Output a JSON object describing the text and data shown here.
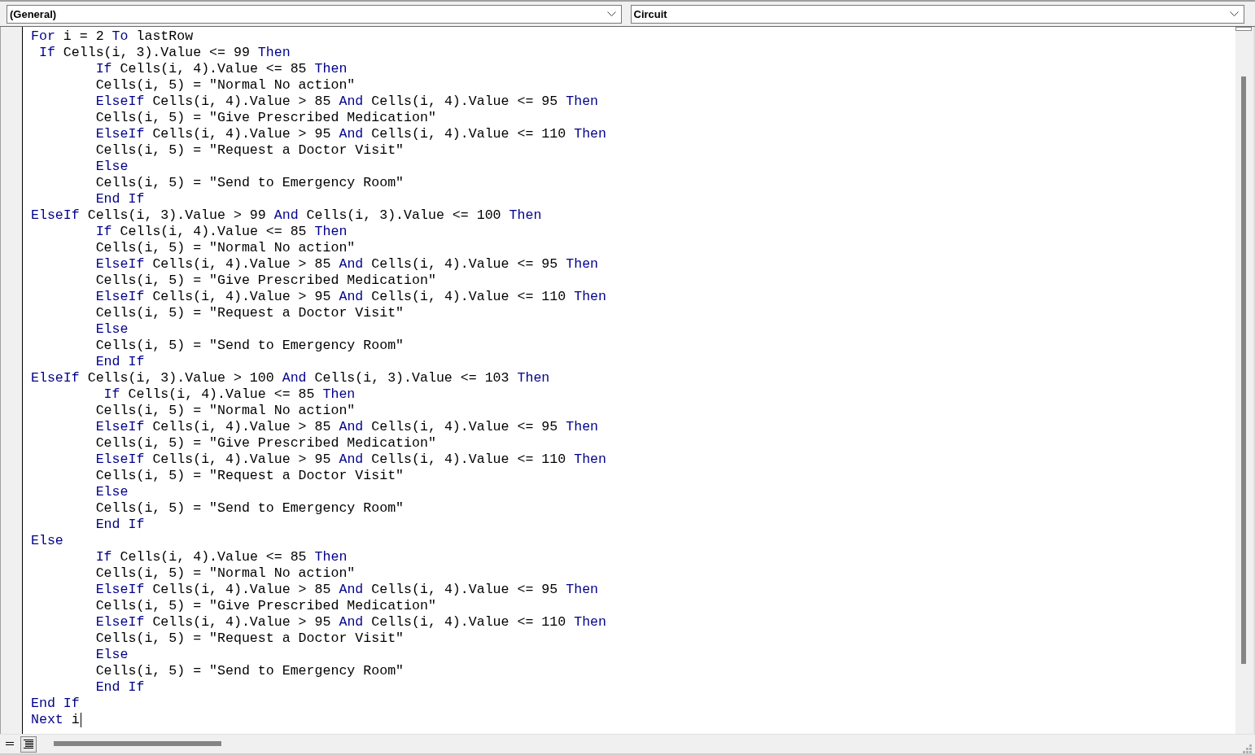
{
  "object_dropdown": {
    "value": "(General)"
  },
  "procedure_dropdown": {
    "value": "Circuit"
  },
  "code_lines": [
    [
      {
        "kind": "keyword",
        "text": "For"
      },
      {
        "kind": "plain",
        "text": " i = 2 "
      },
      {
        "kind": "keyword",
        "text": "To"
      },
      {
        "kind": "plain",
        "text": " lastRow"
      }
    ],
    [
      {
        "kind": "keyword",
        "text": " If"
      },
      {
        "kind": "plain",
        "text": " Cells(i, 3).Value <= 99 "
      },
      {
        "kind": "keyword",
        "text": "Then"
      }
    ],
    [
      {
        "kind": "keyword",
        "text": "        If"
      },
      {
        "kind": "plain",
        "text": " Cells(i, 4).Value <= 85 "
      },
      {
        "kind": "keyword",
        "text": "Then"
      }
    ],
    [
      {
        "kind": "plain",
        "text": "        Cells(i, 5) = \"Normal No action\""
      }
    ],
    [
      {
        "kind": "keyword",
        "text": "        ElseIf"
      },
      {
        "kind": "plain",
        "text": " Cells(i, 4).Value > 85 "
      },
      {
        "kind": "keyword",
        "text": "And"
      },
      {
        "kind": "plain",
        "text": " Cells(i, 4).Value <= 95 "
      },
      {
        "kind": "keyword",
        "text": "Then"
      }
    ],
    [
      {
        "kind": "plain",
        "text": "        Cells(i, 5) = \"Give Prescribed Medication\""
      }
    ],
    [
      {
        "kind": "keyword",
        "text": "        ElseIf"
      },
      {
        "kind": "plain",
        "text": " Cells(i, 4).Value > 95 "
      },
      {
        "kind": "keyword",
        "text": "And"
      },
      {
        "kind": "plain",
        "text": " Cells(i, 4).Value <= 110 "
      },
      {
        "kind": "keyword",
        "text": "Then"
      }
    ],
    [
      {
        "kind": "plain",
        "text": "        Cells(i, 5) = \"Request a Doctor Visit\""
      }
    ],
    [
      {
        "kind": "keyword",
        "text": "        Else"
      }
    ],
    [
      {
        "kind": "plain",
        "text": "        Cells(i, 5) = \"Send to Emergency Room\""
      }
    ],
    [
      {
        "kind": "keyword",
        "text": "        End If"
      }
    ],
    [
      {
        "kind": "keyword",
        "text": "ElseIf"
      },
      {
        "kind": "plain",
        "text": " Cells(i, 3).Value > 99 "
      },
      {
        "kind": "keyword",
        "text": "And"
      },
      {
        "kind": "plain",
        "text": " Cells(i, 3).Value <= 100 "
      },
      {
        "kind": "keyword",
        "text": "Then"
      }
    ],
    [
      {
        "kind": "keyword",
        "text": "        If"
      },
      {
        "kind": "plain",
        "text": " Cells(i, 4).Value <= 85 "
      },
      {
        "kind": "keyword",
        "text": "Then"
      }
    ],
    [
      {
        "kind": "plain",
        "text": "        Cells(i, 5) = \"Normal No action\""
      }
    ],
    [
      {
        "kind": "keyword",
        "text": "        ElseIf"
      },
      {
        "kind": "plain",
        "text": " Cells(i, 4).Value > 85 "
      },
      {
        "kind": "keyword",
        "text": "And"
      },
      {
        "kind": "plain",
        "text": " Cells(i, 4).Value <= 95 "
      },
      {
        "kind": "keyword",
        "text": "Then"
      }
    ],
    [
      {
        "kind": "plain",
        "text": "        Cells(i, 5) = \"Give Prescribed Medication\""
      }
    ],
    [
      {
        "kind": "keyword",
        "text": "        ElseIf"
      },
      {
        "kind": "plain",
        "text": " Cells(i, 4).Value > 95 "
      },
      {
        "kind": "keyword",
        "text": "And"
      },
      {
        "kind": "plain",
        "text": " Cells(i, 4).Value <= 110 "
      },
      {
        "kind": "keyword",
        "text": "Then"
      }
    ],
    [
      {
        "kind": "plain",
        "text": "        Cells(i, 5) = \"Request a Doctor Visit\""
      }
    ],
    [
      {
        "kind": "keyword",
        "text": "        Else"
      }
    ],
    [
      {
        "kind": "plain",
        "text": "        Cells(i, 5) = \"Send to Emergency Room\""
      }
    ],
    [
      {
        "kind": "keyword",
        "text": "        End If"
      }
    ],
    [
      {
        "kind": "keyword",
        "text": "ElseIf"
      },
      {
        "kind": "plain",
        "text": " Cells(i, 3).Value > 100 "
      },
      {
        "kind": "keyword",
        "text": "And"
      },
      {
        "kind": "plain",
        "text": " Cells(i, 3).Value <= 103 "
      },
      {
        "kind": "keyword",
        "text": "Then"
      }
    ],
    [
      {
        "kind": "keyword",
        "text": "         If"
      },
      {
        "kind": "plain",
        "text": " Cells(i, 4).Value <= 85 "
      },
      {
        "kind": "keyword",
        "text": "Then"
      }
    ],
    [
      {
        "kind": "plain",
        "text": "        Cells(i, 5) = \"Normal No action\""
      }
    ],
    [
      {
        "kind": "keyword",
        "text": "        ElseIf"
      },
      {
        "kind": "plain",
        "text": " Cells(i, 4).Value > 85 "
      },
      {
        "kind": "keyword",
        "text": "And"
      },
      {
        "kind": "plain",
        "text": " Cells(i, 4).Value <= 95 "
      },
      {
        "kind": "keyword",
        "text": "Then"
      }
    ],
    [
      {
        "kind": "plain",
        "text": "        Cells(i, 5) = \"Give Prescribed Medication\""
      }
    ],
    [
      {
        "kind": "keyword",
        "text": "        ElseIf"
      },
      {
        "kind": "plain",
        "text": " Cells(i, 4).Value > 95 "
      },
      {
        "kind": "keyword",
        "text": "And"
      },
      {
        "kind": "plain",
        "text": " Cells(i, 4).Value <= 110 "
      },
      {
        "kind": "keyword",
        "text": "Then"
      }
    ],
    [
      {
        "kind": "plain",
        "text": "        Cells(i, 5) = \"Request a Doctor Visit\""
      }
    ],
    [
      {
        "kind": "keyword",
        "text": "        Else"
      }
    ],
    [
      {
        "kind": "plain",
        "text": "        Cells(i, 5) = \"Send to Emergency Room\""
      }
    ],
    [
      {
        "kind": "keyword",
        "text": "        End If"
      }
    ],
    [
      {
        "kind": "keyword",
        "text": "Else"
      }
    ],
    [
      {
        "kind": "keyword",
        "text": "        If"
      },
      {
        "kind": "plain",
        "text": " Cells(i, 4).Value <= 85 "
      },
      {
        "kind": "keyword",
        "text": "Then"
      }
    ],
    [
      {
        "kind": "plain",
        "text": "        Cells(i, 5) = \"Normal No action\""
      }
    ],
    [
      {
        "kind": "keyword",
        "text": "        ElseIf"
      },
      {
        "kind": "plain",
        "text": " Cells(i, 4).Value > 85 "
      },
      {
        "kind": "keyword",
        "text": "And"
      },
      {
        "kind": "plain",
        "text": " Cells(i, 4).Value <= 95 "
      },
      {
        "kind": "keyword",
        "text": "Then"
      }
    ],
    [
      {
        "kind": "plain",
        "text": "        Cells(i, 5) = \"Give Prescribed Medication\""
      }
    ],
    [
      {
        "kind": "keyword",
        "text": "        ElseIf"
      },
      {
        "kind": "plain",
        "text": " Cells(i, 4).Value > 95 "
      },
      {
        "kind": "keyword",
        "text": "And"
      },
      {
        "kind": "plain",
        "text": " Cells(i, 4).Value <= 110 "
      },
      {
        "kind": "keyword",
        "text": "Then"
      }
    ],
    [
      {
        "kind": "plain",
        "text": "        Cells(i, 5) = \"Request a Doctor Visit\""
      }
    ],
    [
      {
        "kind": "keyword",
        "text": "        Else"
      }
    ],
    [
      {
        "kind": "plain",
        "text": "        Cells(i, 5) = \"Send to Emergency Room\""
      }
    ],
    [
      {
        "kind": "keyword",
        "text": "        End If"
      }
    ],
    [
      {
        "kind": "keyword",
        "text": "End If"
      }
    ],
    [
      {
        "kind": "keyword",
        "text": "Next"
      },
      {
        "kind": "plain",
        "text": " i"
      }
    ]
  ]
}
